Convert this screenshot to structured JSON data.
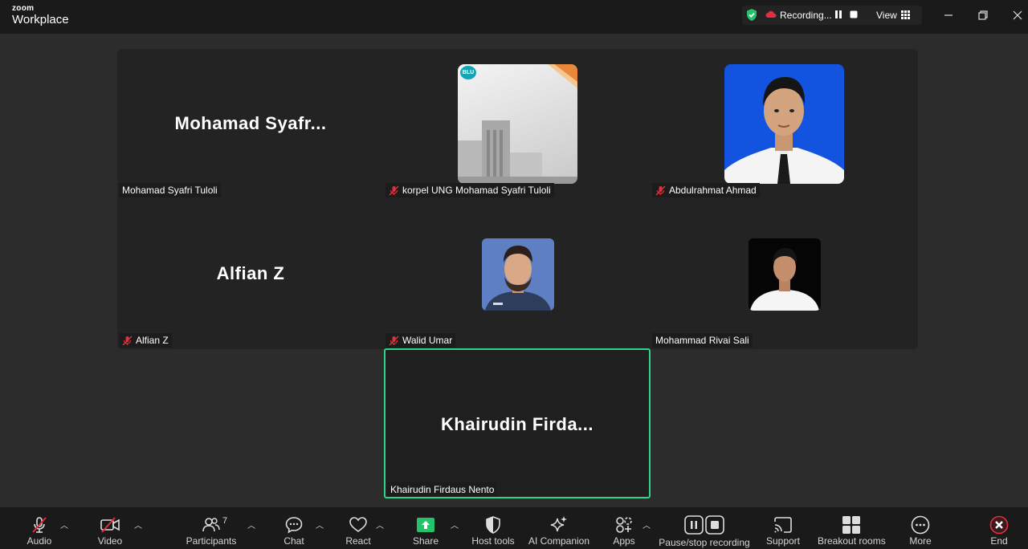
{
  "app": {
    "brand_top": "zoom",
    "brand_bottom": "Workplace"
  },
  "topbar": {
    "recording_label": "Recording...",
    "view_label": "View"
  },
  "participants": [
    {
      "display_name": "Mohamad  Syafr...",
      "label": "Mohamad Syafri Tuloli",
      "muted": false
    },
    {
      "label": "korpel UNG Mohamad Syafri Tuloli",
      "muted": true,
      "avatar_badge": "BLU"
    },
    {
      "label": "Abdulrahmat Ahmad",
      "muted": true
    },
    {
      "display_name": "Alfian Z",
      "label": "Alfian Z",
      "muted": true
    },
    {
      "label": "Walid Umar",
      "muted": true
    },
    {
      "label": "Mohammad Rivai Sali",
      "muted": false
    }
  ],
  "self": {
    "display_name": "Khairudin  Firda...",
    "label": "Khairudin Firdaus Nento"
  },
  "toolbar": {
    "audio": "Audio",
    "video": "Video",
    "participants": "Participants",
    "participants_count": "7",
    "chat": "Chat",
    "react": "React",
    "share": "Share",
    "host_tools": "Host tools",
    "ai_companion": "AI Companion",
    "apps": "Apps",
    "pause_stop_recording": "Pause/stop recording",
    "support": "Support",
    "breakout_rooms": "Breakout rooms",
    "more": "More",
    "end": "End"
  },
  "colors": {
    "accent_green": "#2fd38b",
    "share_green": "#23c26b",
    "end_red": "#e0303c",
    "muted_red": "#e0303c"
  }
}
